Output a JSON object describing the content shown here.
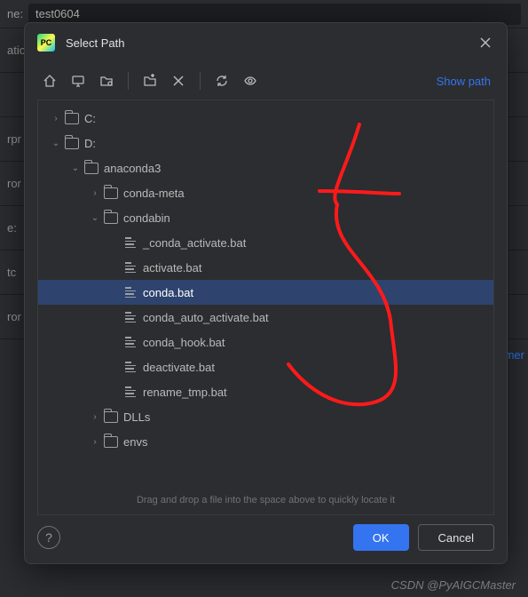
{
  "background": {
    "name_label": "ne:",
    "name_value": "test0604",
    "rows": [
      "atic",
      "",
      "rpr",
      "ror",
      "e:",
      " tc",
      "ror"
    ],
    "right_link": "onmer"
  },
  "dialog": {
    "title": "Select Path",
    "show_path": "Show path",
    "hint": "Drag and drop a file into the space above to quickly locate it",
    "ok": "OK",
    "cancel": "Cancel",
    "help": "?",
    "toolbar_icons": [
      "home-icon",
      "desktop-icon",
      "project-icon",
      "new-folder-icon",
      "delete-icon",
      "refresh-icon",
      "show-hidden-icon"
    ]
  },
  "tree": [
    {
      "depth": 0,
      "expand": "right",
      "icon": "folder",
      "label": "C:"
    },
    {
      "depth": 0,
      "expand": "down",
      "icon": "folder",
      "label": "D:"
    },
    {
      "depth": 1,
      "expand": "down",
      "icon": "folder",
      "label": "anaconda3"
    },
    {
      "depth": 2,
      "expand": "right",
      "icon": "folder",
      "label": "conda-meta"
    },
    {
      "depth": 2,
      "expand": "down",
      "icon": "folder",
      "label": "condabin"
    },
    {
      "depth": 3,
      "expand": "",
      "icon": "file",
      "label": "_conda_activate.bat"
    },
    {
      "depth": 3,
      "expand": "",
      "icon": "file",
      "label": "activate.bat"
    },
    {
      "depth": 3,
      "expand": "",
      "icon": "file",
      "label": "conda.bat",
      "selected": true
    },
    {
      "depth": 3,
      "expand": "",
      "icon": "file",
      "label": "conda_auto_activate.bat"
    },
    {
      "depth": 3,
      "expand": "",
      "icon": "file",
      "label": "conda_hook.bat"
    },
    {
      "depth": 3,
      "expand": "",
      "icon": "file",
      "label": "deactivate.bat"
    },
    {
      "depth": 3,
      "expand": "",
      "icon": "file",
      "label": "rename_tmp.bat"
    },
    {
      "depth": 2,
      "expand": "right",
      "icon": "folder",
      "label": "DLLs"
    },
    {
      "depth": 2,
      "expand": "right",
      "icon": "folder",
      "label": "envs"
    }
  ],
  "watermark": "CSDN @PyAIGCMaster"
}
